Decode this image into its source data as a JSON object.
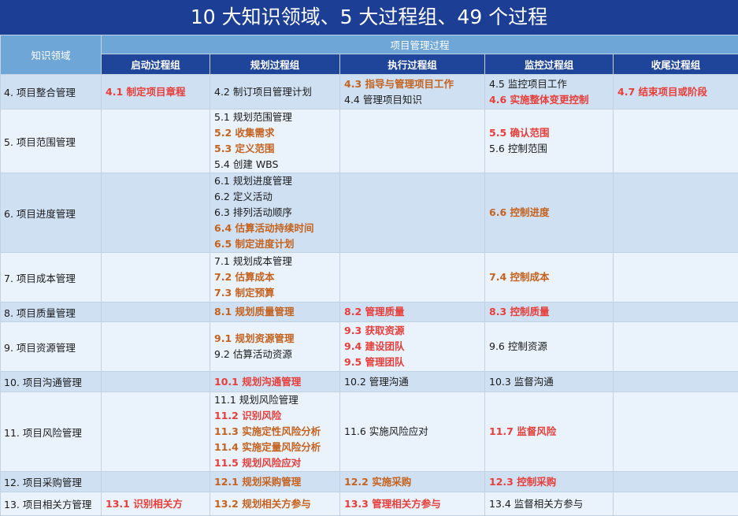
{
  "title": "10 大知识领域、5 大过程组、49 个过程",
  "header": {
    "area": "知识领域",
    "group": "项目管理过程",
    "columns": [
      "启动过程组",
      "规划过程组",
      "执行过程组",
      "监控过程组",
      "收尾过程组"
    ]
  },
  "colors": {
    "title_bg": "#1c3f95",
    "red": "#e83e3a",
    "orange": "#c4621e",
    "black": "#1a1a1a"
  },
  "rows": [
    {
      "area": "4. 项目整合管理",
      "cells": [
        [
          {
            "t": "4.1 制定项目章程",
            "c": "red"
          }
        ],
        [
          {
            "t": "4.2 制订项目管理计划",
            "c": "black"
          }
        ],
        [
          {
            "t": "4.3 指导与管理项目工作",
            "c": "orange"
          },
          {
            "t": "4.4 管理项目知识",
            "c": "black"
          }
        ],
        [
          {
            "t": "4.5 监控项目工作",
            "c": "black"
          },
          {
            "t": "4.6 实施整体变更控制",
            "c": "red"
          }
        ],
        [
          {
            "t": "4.7 结束项目或阶段",
            "c": "red"
          }
        ]
      ]
    },
    {
      "area": "5. 项目范围管理",
      "cells": [
        [],
        [
          {
            "t": "5.1 规划范围管理",
            "c": "black"
          },
          {
            "t": "5.2 收集需求",
            "c": "orange"
          },
          {
            "t": "5.3 定义范围",
            "c": "orange"
          },
          {
            "t": "5.4 创建 WBS",
            "c": "black"
          }
        ],
        [],
        [
          {
            "t": "5.5 确认范围",
            "c": "red"
          },
          {
            "t": "5.6 控制范围",
            "c": "black"
          }
        ],
        []
      ]
    },
    {
      "area": "6. 项目进度管理",
      "cells": [
        [],
        [
          {
            "t": "6.1 规划进度管理",
            "c": "black"
          },
          {
            "t": "6.2 定义活动",
            "c": "black"
          },
          {
            "t": "6.3 排列活动顺序",
            "c": "black"
          },
          {
            "t": "6.4 估算活动持续时间",
            "c": "orange"
          },
          {
            "t": "6.5 制定进度计划",
            "c": "orange"
          }
        ],
        [],
        [
          {
            "t": "6.6 控制进度",
            "c": "orange"
          }
        ],
        []
      ]
    },
    {
      "area": "7. 项目成本管理",
      "cells": [
        [],
        [
          {
            "t": "7.1 规划成本管理",
            "c": "black"
          },
          {
            "t": "7.2 估算成本",
            "c": "orange"
          },
          {
            "t": "7.3 制定预算",
            "c": "orange"
          }
        ],
        [],
        [
          {
            "t": "7.4 控制成本",
            "c": "orange"
          }
        ],
        []
      ]
    },
    {
      "area": "8. 项目质量管理",
      "cells": [
        [],
        [
          {
            "t": "8.1 规划质量管理",
            "c": "orange"
          }
        ],
        [
          {
            "t": "8.2 管理质量",
            "c": "red"
          }
        ],
        [
          {
            "t": "8.3 控制质量",
            "c": "red"
          }
        ],
        []
      ]
    },
    {
      "area": "9. 项目资源管理",
      "cells": [
        [],
        [
          {
            "t": "9.1 规划资源管理",
            "c": "orange"
          },
          {
            "t": "9.2 估算活动资源",
            "c": "black"
          }
        ],
        [
          {
            "t": "9.3 获取资源",
            "c": "red"
          },
          {
            "t": "9.4 建设团队",
            "c": "red"
          },
          {
            "t": "9.5 管理团队",
            "c": "red"
          }
        ],
        [
          {
            "t": "9.6 控制资源",
            "c": "black"
          }
        ],
        []
      ]
    },
    {
      "area": "10. 项目沟通管理",
      "cells": [
        [],
        [
          {
            "t": "10.1 规划沟通管理",
            "c": "red"
          }
        ],
        [
          {
            "t": "10.2 管理沟通",
            "c": "black"
          }
        ],
        [
          {
            "t": "10.3 监督沟通",
            "c": "black"
          }
        ],
        []
      ]
    },
    {
      "area": "11. 项目风险管理",
      "cells": [
        [],
        [
          {
            "t": "11.1 规划风险管理",
            "c": "black"
          },
          {
            "t": "11.2 识别风险",
            "c": "red"
          },
          {
            "t": "11.3 实施定性风险分析",
            "c": "orange"
          },
          {
            "t": "11.4 实施定量风险分析",
            "c": "orange"
          },
          {
            "t": "11.5 规划风险应对",
            "c": "red"
          }
        ],
        [
          {
            "t": "11.6 实施风险应对",
            "c": "black"
          }
        ],
        [
          {
            "t": "11.7 监督风险",
            "c": "red"
          }
        ],
        []
      ]
    },
    {
      "area": "12. 项目采购管理",
      "cells": [
        [],
        [
          {
            "t": "12.1 规划采购管理",
            "c": "orange"
          }
        ],
        [
          {
            "t": "12.2 实施采购",
            "c": "orange"
          }
        ],
        [
          {
            "t": "12.3 控制采购",
            "c": "red"
          }
        ],
        []
      ]
    },
    {
      "area": "13. 项目相关方管理",
      "cells": [
        [
          {
            "t": "13.1 识别相关方",
            "c": "red"
          }
        ],
        [
          {
            "t": "13.2 规划相关方参与",
            "c": "orange"
          }
        ],
        [
          {
            "t": "13.3 管理相关方参与",
            "c": "red"
          }
        ],
        [
          {
            "t": "13.4 监督相关方参与",
            "c": "black"
          }
        ],
        []
      ]
    }
  ]
}
